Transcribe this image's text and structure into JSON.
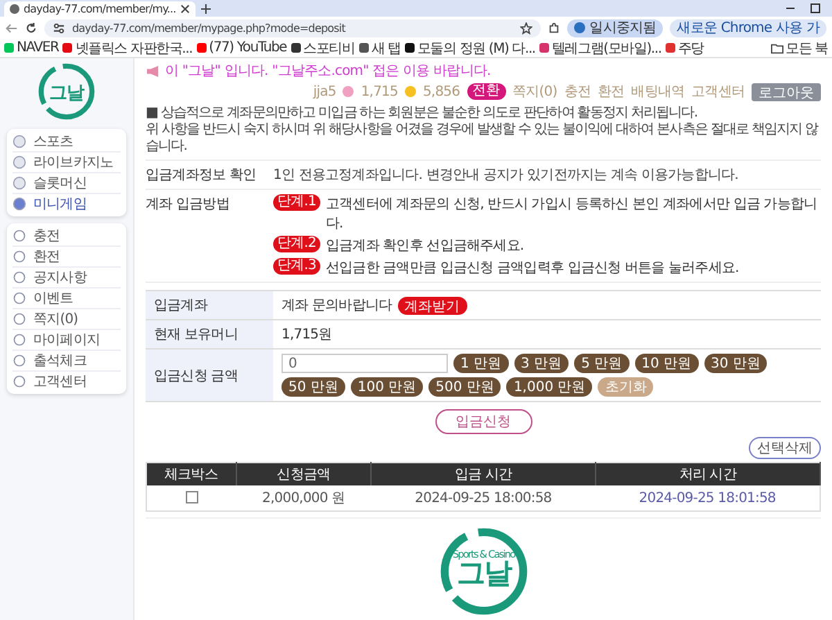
{
  "browser": {
    "tab_title": "dayday-77.com/member/my...",
    "url": "dayday-77.com/member/mypage.php?mode=deposit",
    "profile_label": "일시중지됨",
    "update_label": "새로운 Chrome 사용 가",
    "bookmarks": [
      {
        "label": "NAVER",
        "color": "#03c75a"
      },
      {
        "label": "넷플릭스 자판한국...",
        "color": "#e50914"
      },
      {
        "label": "(77) YouTube",
        "color": "#ff0000"
      },
      {
        "label": "스포티비",
        "color": "#333333"
      },
      {
        "label": "새 탭",
        "color": "#555555"
      },
      {
        "label": "모둘의 정원 (M) 다...",
        "color": "#111111"
      },
      {
        "label": "텔레그램(모바일)...",
        "color": "#d6336c"
      },
      {
        "label": "주당",
        "color": "#e03131"
      }
    ],
    "all_bookmarks_label": "모든 북"
  },
  "header": {
    "announcement": "이 \"그날\" 입니다. \"그날주소.com\" 접은 이용 바랍니다.",
    "username": "jja5",
    "points": "1,715",
    "money": "5,856",
    "convert_label": "전환",
    "nav": [
      "쪽지(0)",
      "충전",
      "환전",
      "배팅내역",
      "고객센터"
    ],
    "logout_label": "로그아웃"
  },
  "sidebar": {
    "logo": {
      "name": "그날"
    },
    "games": [
      {
        "label": "스포츠",
        "selected": false
      },
      {
        "label": "라이브카지노",
        "selected": false
      },
      {
        "label": "슬롯머신",
        "selected": false
      },
      {
        "label": "미니게임",
        "selected": true
      }
    ],
    "menu": [
      "충전",
      "환전",
      "공지사항",
      "이벤트",
      "쪽지(0)",
      "마이페이지",
      "출석체크",
      "고객센터"
    ]
  },
  "notice": {
    "lines": [
      "■ 상습적으로 계좌문의만하고 미입금 하는 회원분은 불순한 의도로 판단하여 활동정지 처리됩니다.",
      "위 사항을 반드시 숙지 하시며 위 해당사항을 어겼을 경우에 발생할 수 있는 불이익에 대하여 본사측은 절대로 책임지지 않습니다."
    ]
  },
  "account_info": {
    "label": "입금계좌정보 확인",
    "text": "1인 전용고정계좌입니다. 변경안내 공지가 있기전까지는 계속 이용가능합니다."
  },
  "method": {
    "label": "계좌 입금방법",
    "steps": [
      {
        "badge": "단계.1",
        "text": "고객센터에 계좌문의 신청, 반드시 가입시 등록하신 본인 계좌에서만 입금 가능합니다."
      },
      {
        "badge": "단계.2",
        "text": "입금계좌 확인후 선입금해주세요."
      },
      {
        "badge": "단계.3",
        "text": "선입금한 금액만큼 입금신청 금액입력후 입금신청 버튼을 눌러주세요."
      }
    ]
  },
  "form": {
    "account_label": "입금계좌",
    "account_text": "계좌 문의바랍니다",
    "account_button": "계좌받기",
    "balance_label": "현재 보유머니",
    "balance": "1,715원",
    "amount_label": "입금신청 금액",
    "amount_value": "0",
    "amounts": [
      "1 만원",
      "3 만원",
      "5 만원",
      "10 만원",
      "30 만원",
      "50 만원",
      "100 만원",
      "500 만원",
      "1,000 만원"
    ],
    "reset_label": "초기화"
  },
  "submit_label": "입금신청",
  "delete_label": "선택삭제",
  "history": {
    "columns": [
      "체크박스",
      "신청금액",
      "입금 시간",
      "처리 시간"
    ],
    "rows": [
      {
        "checked": false,
        "amount": "2,000,000 원",
        "deposit_time": "2024-09-25 18:00:58",
        "process_time": "2024-09-25 18:01:58"
      }
    ]
  },
  "footer": {
    "logo": {
      "name": "그날",
      "tagline": "Sports & Casino"
    }
  }
}
